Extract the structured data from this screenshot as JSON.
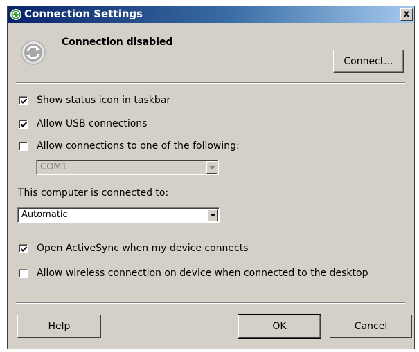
{
  "window": {
    "title": "Connection Settings",
    "close_label": "x"
  },
  "status": {
    "text": "Connection disabled",
    "connect_button": "Connect..."
  },
  "options": {
    "show_status_icon": {
      "label": "Show status icon in taskbar",
      "checked": true
    },
    "allow_usb": {
      "label": "Allow USB connections",
      "checked": true
    },
    "allow_ports": {
      "label": "Allow connections to one of the following:",
      "checked": false
    },
    "port_select": {
      "value": "COM1",
      "enabled": false
    },
    "computer_connected_label": "This computer is connected to:",
    "network_select": {
      "value": "Automatic",
      "enabled": true
    },
    "open_activesync": {
      "label": "Open ActiveSync when my device connects",
      "checked": true
    },
    "allow_wireless": {
      "label": "Allow wireless connection on device when connected to the desktop",
      "checked": false
    }
  },
  "footer": {
    "help_button": "Help",
    "ok_button": "OK",
    "cancel_button": "Cancel"
  },
  "colors": {
    "dialog_face": "#d4d0c8",
    "title_start": "#0a246a",
    "title_end": "#a6caf0",
    "icon_green": "#3c9a3c"
  }
}
